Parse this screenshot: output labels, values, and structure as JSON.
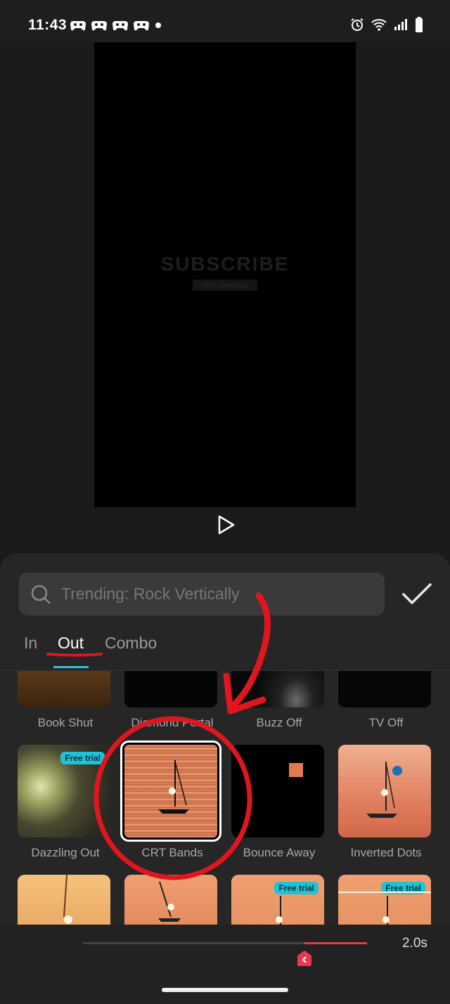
{
  "status_bar": {
    "time": "11:43"
  },
  "preview": {
    "overlay_title": "SUBSCRIBE",
    "overlay_subtitle": "OUR CHANNEL"
  },
  "search": {
    "placeholder": "Trending: Rock Vertically"
  },
  "tabs": [
    {
      "label": "In",
      "active": false
    },
    {
      "label": "Out",
      "active": true
    },
    {
      "label": "Combo",
      "active": false
    }
  ],
  "animations": {
    "row1": [
      {
        "label": "Book Shut"
      },
      {
        "label": "Diamond Portal"
      },
      {
        "label": "Buzz Off"
      },
      {
        "label": "TV Off"
      }
    ],
    "row2": [
      {
        "label": "Dazzling Out",
        "badge": "Free trial"
      },
      {
        "label": "CRT Bands",
        "selected": true
      },
      {
        "label": "Bounce Away"
      },
      {
        "label": "Inverted Dots"
      }
    ],
    "row3_badges": [
      "Free trial",
      "Free trial"
    ]
  },
  "timeline": {
    "duration": "2.0s",
    "progress": 0.78
  },
  "colors": {
    "accent": "#2ec5d8",
    "track_fill": "#e8394f",
    "annotation": "#e0161f",
    "badge": "#1fc3d6"
  }
}
